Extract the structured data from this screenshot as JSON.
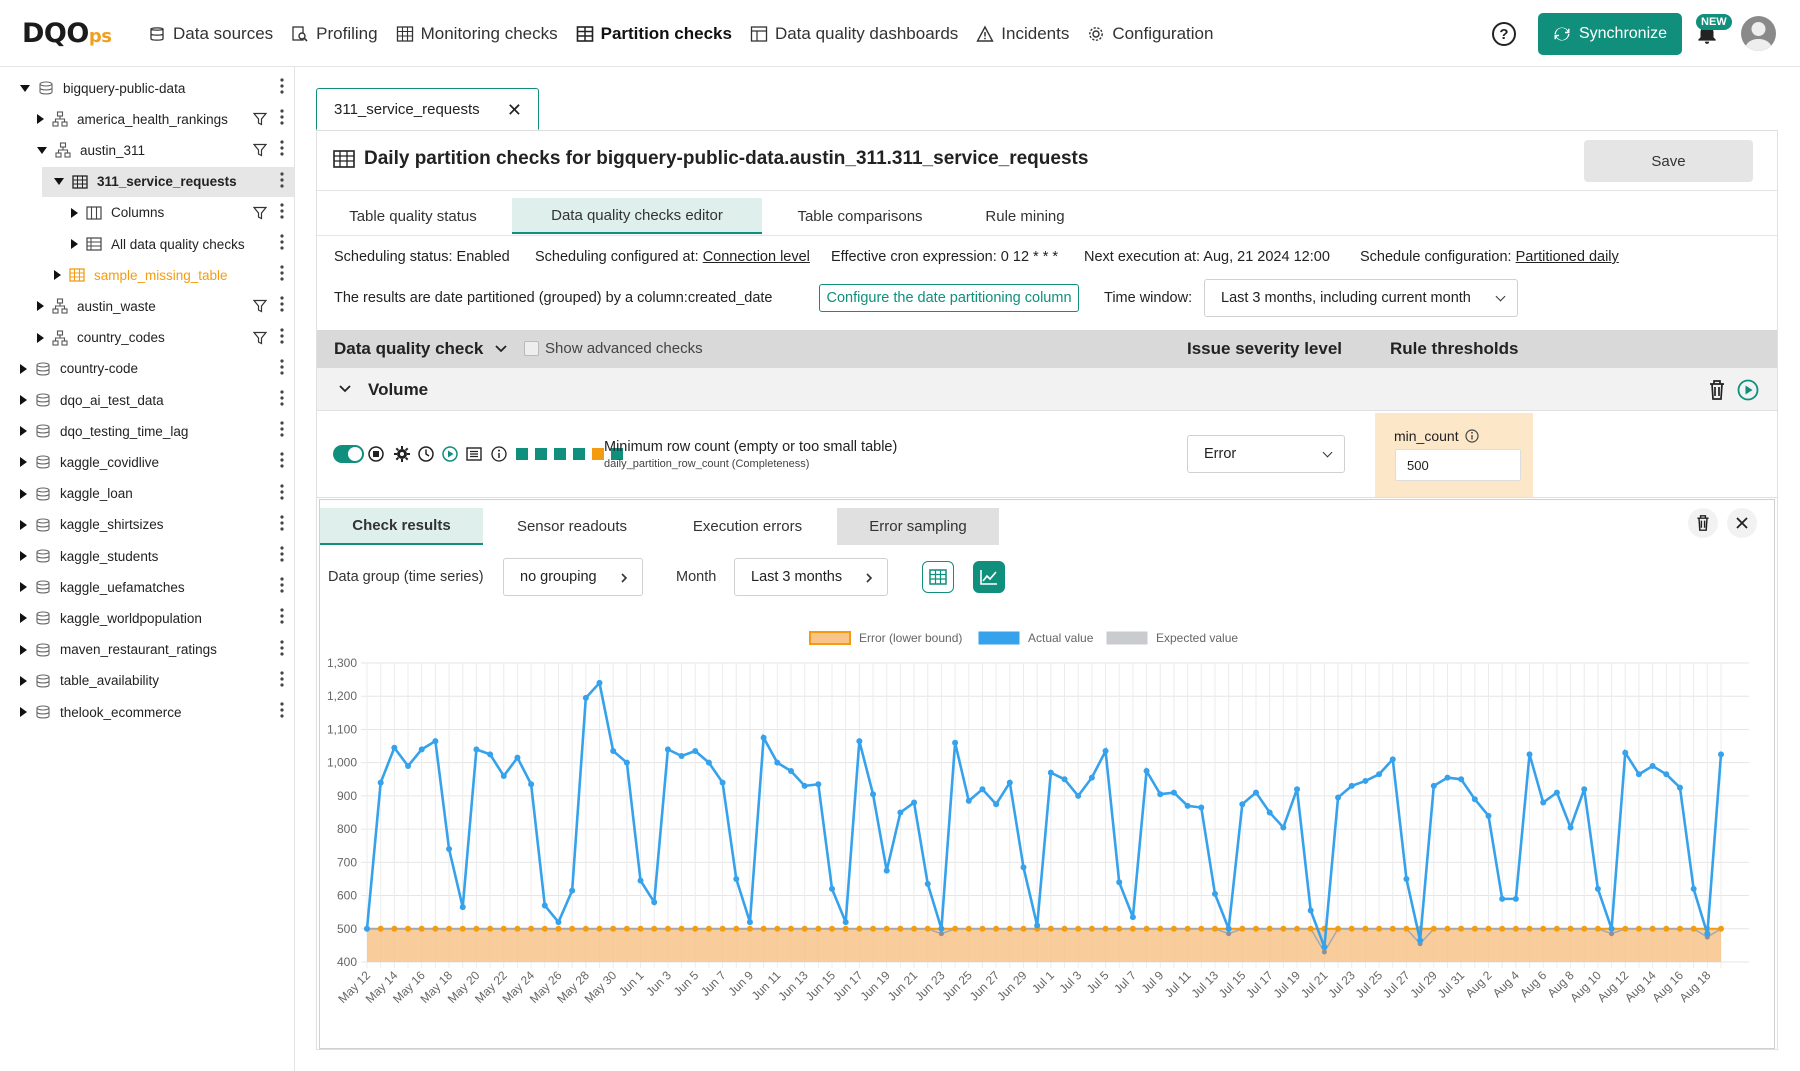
{
  "app": {
    "logo_main": "DQO",
    "logo_suffix": "ps"
  },
  "nav": {
    "items": [
      {
        "label": "Data sources",
        "icon": "database-icon"
      },
      {
        "label": "Profiling",
        "icon": "profiling-icon"
      },
      {
        "label": "Monitoring checks",
        "icon": "table-icon"
      },
      {
        "label": "Partition checks",
        "icon": "partition-icon",
        "active": true
      },
      {
        "label": "Data quality dashboards",
        "icon": "dashboard-icon"
      },
      {
        "label": "Incidents",
        "icon": "warning-icon"
      },
      {
        "label": "Configuration",
        "icon": "gear-icon"
      }
    ],
    "sync_label": "Synchronize",
    "new_badge": "NEW",
    "help": "?"
  },
  "sidebar": {
    "items": [
      {
        "label": "bigquery-public-data",
        "level": 0,
        "expanded": true,
        "type": "db"
      },
      {
        "label": "america_health_rankings",
        "level": 1,
        "expanded": false,
        "type": "schema",
        "filter": true
      },
      {
        "label": "austin_311",
        "level": 1,
        "expanded": true,
        "type": "schema",
        "filter": true
      },
      {
        "label": "311_service_requests",
        "level": 2,
        "expanded": true,
        "type": "table",
        "selected": true
      },
      {
        "label": "Columns",
        "level": 3,
        "expanded": false,
        "type": "columns",
        "filter": true
      },
      {
        "label": "All data quality checks",
        "level": 3,
        "expanded": false,
        "type": "checks"
      },
      {
        "label": "sample_missing_table",
        "level": 2,
        "expanded": false,
        "type": "table-orange"
      },
      {
        "label": "austin_waste",
        "level": 1,
        "expanded": false,
        "type": "schema",
        "filter": true
      },
      {
        "label": "country_codes",
        "level": 1,
        "expanded": false,
        "type": "schema",
        "filter": true
      },
      {
        "label": "country-code",
        "level": 0,
        "expanded": false,
        "type": "db"
      },
      {
        "label": "dqo_ai_test_data",
        "level": 0,
        "expanded": false,
        "type": "db"
      },
      {
        "label": "dqo_testing_time_lag",
        "level": 0,
        "expanded": false,
        "type": "db"
      },
      {
        "label": "kaggle_covidlive",
        "level": 0,
        "expanded": false,
        "type": "db"
      },
      {
        "label": "kaggle_loan",
        "level": 0,
        "expanded": false,
        "type": "db"
      },
      {
        "label": "kaggle_shirtsizes",
        "level": 0,
        "expanded": false,
        "type": "db"
      },
      {
        "label": "kaggle_students",
        "level": 0,
        "expanded": false,
        "type": "db"
      },
      {
        "label": "kaggle_uefamatches",
        "level": 0,
        "expanded": false,
        "type": "db"
      },
      {
        "label": "kaggle_worldpopulation",
        "level": 0,
        "expanded": false,
        "type": "db"
      },
      {
        "label": "maven_restaurant_ratings",
        "level": 0,
        "expanded": false,
        "type": "db"
      },
      {
        "label": "table_availability",
        "level": 0,
        "expanded": false,
        "type": "db"
      },
      {
        "label": "thelook_ecommerce",
        "level": 0,
        "expanded": false,
        "type": "db"
      }
    ]
  },
  "main": {
    "file_tab": "311_service_requests",
    "file_tab_close": "✕",
    "title": "Daily partition checks for bigquery-public-data.austin_311.311_service_requests",
    "save_label": "Save",
    "subtabs": [
      "Table quality status",
      "Data quality checks editor",
      "Table comparisons",
      "Rule mining"
    ],
    "active_subtab": 1,
    "scheduling_status": "Scheduling status: Enabled",
    "scheduling_configured_prefix": "Scheduling configured at:",
    "scheduling_configured_link": "Connection level",
    "cron": "Effective cron expression: 0 12 * * *",
    "next_execution": "Next execution at: Aug, 21 2024 12:00",
    "schedule_config_prefix": "Schedule configuration:",
    "schedule_config_link": "Partitioned daily",
    "partition_text": "The results are date partitioned (grouped) by a column:created_date",
    "configure_btn": "Configure the date partitioning column",
    "time_window_label": "Time window:",
    "time_window_value": "Last 3 months, including current month",
    "header": {
      "check_col": "Data quality check",
      "advanced_label": "Show advanced checks",
      "severity_col": "Issue severity level",
      "thresholds_col": "Rule thresholds"
    },
    "group": "Volume",
    "check": {
      "name": "Minimum row count (empty or too small table)",
      "sub": "daily_partition_row_count (Completeness)",
      "severity": "Error",
      "rule_label": "min_count",
      "rule_value": "500",
      "status_colors": [
        "#0f8f7c",
        "#0f8f7c",
        "#0f8f7c",
        "#0f8f7c",
        "#f39c12",
        "#0f8f7c"
      ]
    },
    "results": {
      "tabs": [
        "Check results",
        "Sensor readouts",
        "Execution errors",
        "Error sampling"
      ],
      "active_tab": 0,
      "data_group_label": "Data group (time series)",
      "data_group_value": "no grouping",
      "month_label": "Month",
      "month_value": "Last 3 months"
    }
  },
  "chart_data": {
    "type": "line",
    "legend": [
      {
        "name": "Error (lower bound)",
        "color": "#f8c48a",
        "border": "#f39c12"
      },
      {
        "name": "Actual value",
        "color": "#36a2eb"
      },
      {
        "name": "Expected value",
        "color": "#c9cbcf"
      }
    ],
    "legend_position": "top",
    "ylim": [
      400,
      1300
    ],
    "yticks": [
      400,
      500,
      600,
      700,
      800,
      900,
      "1,000",
      "1,100",
      "1,200",
      "1,300"
    ],
    "ytick_values": [
      400,
      500,
      600,
      700,
      800,
      900,
      1000,
      1100,
      1200,
      1300
    ],
    "xtick_labels": [
      "May 12",
      "May 14",
      "May 16",
      "May 18",
      "May 20",
      "May 22",
      "May 24",
      "May 26",
      "May 28",
      "May 30",
      "Jun 1",
      "Jun 3",
      "Jun 5",
      "Jun 7",
      "Jun 9",
      "Jun 11",
      "Jun 13",
      "Jun 15",
      "Jun 17",
      "Jun 19",
      "Jun 21",
      "Jun 23",
      "Jun 25",
      "Jun 27",
      "Jun 29",
      "Jul 1",
      "Jul 3",
      "Jul 5",
      "Jul 7",
      "Jul 9",
      "Jul 11",
      "Jul 13",
      "Jul 15",
      "Jul 17",
      "Jul 19",
      "Jul 21",
      "Jul 23",
      "Jul 25",
      "Jul 27",
      "Jul 29",
      "Jul 31",
      "Aug 2",
      "Aug 4",
      "Aug 6",
      "Aug 8",
      "Aug 10",
      "Aug 12",
      "Aug 14",
      "Aug 16",
      "Aug 18"
    ],
    "error_lower_bound": 500,
    "actual_values": [
      500,
      940,
      1045,
      990,
      1040,
      1065,
      740,
      565,
      1040,
      1025,
      960,
      1015,
      935,
      570,
      520,
      615,
      1195,
      1240,
      1035,
      1000,
      645,
      580,
      1040,
      1020,
      1035,
      1000,
      940,
      650,
      520,
      1075,
      1000,
      975,
      930,
      935,
      620,
      520,
      1065,
      905,
      675,
      850,
      880,
      635,
      500,
      1060,
      885,
      920,
      875,
      940,
      685,
      510,
      970,
      950,
      900,
      955,
      1035,
      640,
      535,
      975,
      905,
      910,
      870,
      865,
      605,
      500,
      875,
      910,
      850,
      805,
      920,
      555,
      445,
      895,
      930,
      945,
      965,
      1010,
      650,
      465,
      930,
      955,
      950,
      890,
      840,
      590,
      590,
      1025,
      880,
      910,
      805,
      920,
      620,
      500,
      1030,
      965,
      990,
      965,
      925,
      620,
      485,
      1025
    ],
    "expected_values": [
      500,
      500,
      500,
      500,
      500,
      500,
      500,
      500,
      500,
      500,
      500,
      500,
      500,
      500,
      500,
      500,
      500,
      500,
      500,
      500,
      500,
      500,
      500,
      500,
      500,
      500,
      500,
      500,
      500,
      500,
      500,
      500,
      500,
      500,
      500,
      500,
      500,
      500,
      500,
      500,
      500,
      500,
      485,
      500,
      500,
      500,
      500,
      500,
      500,
      500,
      500,
      500,
      500,
      500,
      500,
      500,
      500,
      500,
      500,
      500,
      500,
      500,
      500,
      485,
      500,
      500,
      500,
      500,
      500,
      500,
      430,
      500,
      500,
      500,
      500,
      500,
      500,
      455,
      500,
      500,
      500,
      500,
      500,
      500,
      500,
      500,
      500,
      500,
      500,
      500,
      500,
      485,
      500,
      500,
      500,
      500,
      500,
      500,
      475,
      500
    ]
  }
}
